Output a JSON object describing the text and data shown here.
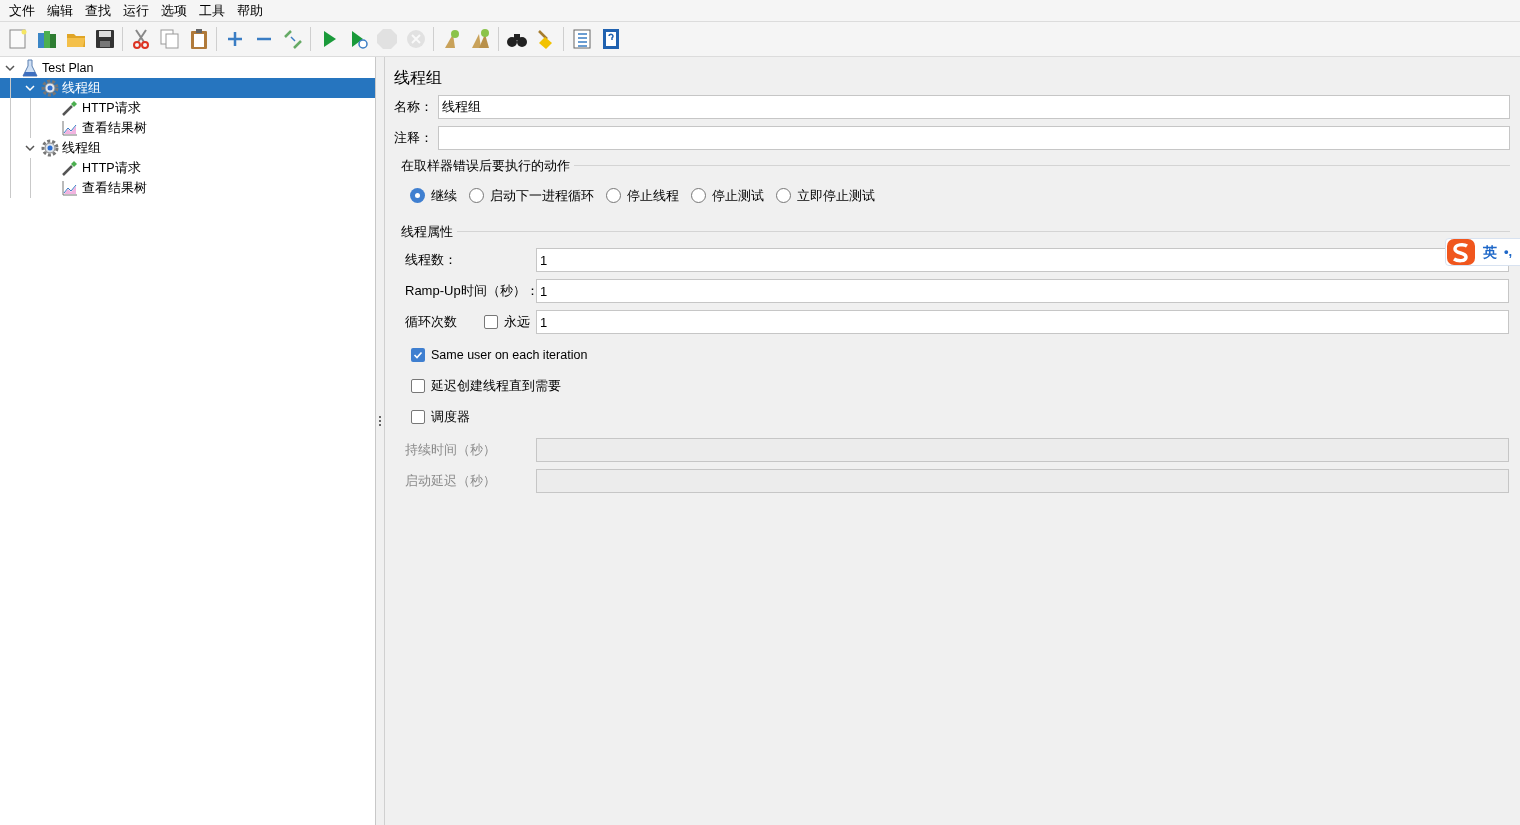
{
  "menu": [
    "文件",
    "编辑",
    "查找",
    "运行",
    "选项",
    "工具",
    "帮助"
  ],
  "toolbar": [
    {
      "kind": "new",
      "disabled": false
    },
    {
      "kind": "templates",
      "disabled": false
    },
    {
      "kind": "open",
      "disabled": false
    },
    {
      "kind": "save",
      "disabled": false
    },
    {
      "kind": "separator"
    },
    {
      "kind": "cut",
      "disabled": false
    },
    {
      "kind": "copy",
      "disabled": false
    },
    {
      "kind": "paste",
      "disabled": false
    },
    {
      "kind": "separator"
    },
    {
      "kind": "expand",
      "disabled": false
    },
    {
      "kind": "collapse",
      "disabled": false
    },
    {
      "kind": "toggle",
      "disabled": false
    },
    {
      "kind": "separator"
    },
    {
      "kind": "start",
      "disabled": false
    },
    {
      "kind": "start_no_pause",
      "disabled": false
    },
    {
      "kind": "stop",
      "disabled": true
    },
    {
      "kind": "shutdown",
      "disabled": true
    },
    {
      "kind": "separator"
    },
    {
      "kind": "clear",
      "disabled": false
    },
    {
      "kind": "clear_all",
      "disabled": false
    },
    {
      "kind": "separator"
    },
    {
      "kind": "search",
      "disabled": false
    },
    {
      "kind": "reset_search",
      "disabled": false
    },
    {
      "kind": "separator"
    },
    {
      "kind": "functions",
      "disabled": false
    },
    {
      "kind": "help",
      "disabled": false
    }
  ],
  "tree": [
    {
      "label": "Test Plan",
      "kind": "plan",
      "expanded": true,
      "selected": false,
      "children": [
        {
          "label": "线程组",
          "kind": "thread_group",
          "expanded": true,
          "selected": true,
          "children": [
            {
              "label": "HTTP请求",
              "kind": "sampler",
              "selected": false
            },
            {
              "label": "查看结果树",
              "kind": "listener",
              "selected": false
            }
          ]
        },
        {
          "label": "线程组",
          "kind": "thread_group",
          "expanded": true,
          "selected": false,
          "children": [
            {
              "label": "HTTP请求",
              "kind": "sampler",
              "selected": false
            },
            {
              "label": "查看结果树",
              "kind": "listener",
              "selected": false
            }
          ]
        }
      ]
    }
  ],
  "panel": {
    "title": "线程组",
    "name": {
      "label": "名称：",
      "value": "线程组"
    },
    "comment": {
      "label": "注释："
    },
    "error_action": {
      "legend": "在取样器错误后要执行的动作",
      "options": [
        {
          "label": "继续",
          "selected": true
        },
        {
          "label": "启动下一进程循环",
          "selected": false
        },
        {
          "label": "停止线程",
          "selected": false
        },
        {
          "label": "停止测试",
          "selected": false
        },
        {
          "label": "立即停止测试",
          "selected": false
        }
      ]
    },
    "thread_properties": {
      "legend": "线程属性",
      "fields": [
        {
          "kind": "text",
          "label": "线程数：",
          "value": "1"
        },
        {
          "kind": "text",
          "label": "Ramp-Up时间（秒）：",
          "value": "1"
        },
        {
          "kind": "loop",
          "label": "循环次数",
          "checkbox": {
            "label": "永远",
            "checked": false
          },
          "value": "1"
        }
      ],
      "options": [
        {
          "label": "Same user on each iteration",
          "checked": true
        },
        {
          "label": "延迟创建线程直到需要",
          "checked": false
        },
        {
          "label": "调度器",
          "checked": false
        }
      ],
      "schedule_fields": [
        {
          "label": "持续时间（秒）",
          "disabled": true
        },
        {
          "label": "启动延迟（秒）",
          "disabled": true
        }
      ]
    }
  },
  "ime": {
    "mode": "英",
    "punct": "•,"
  }
}
